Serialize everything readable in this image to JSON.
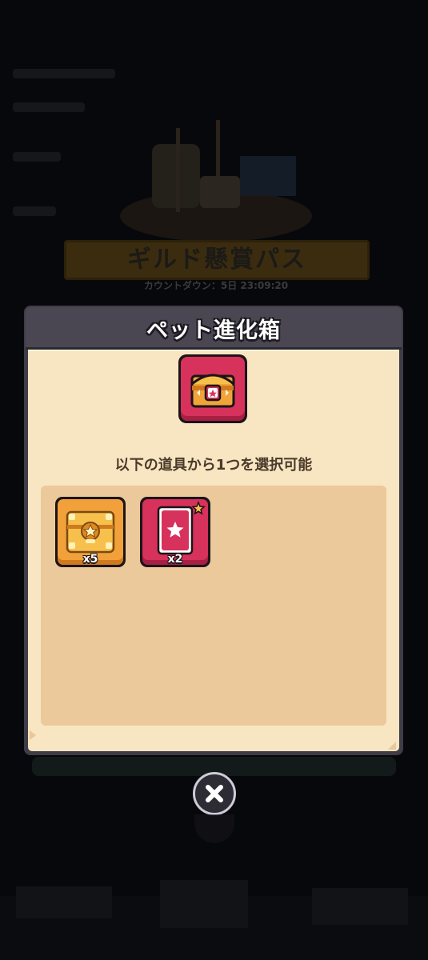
{
  "background": {
    "banner_title": "ギルド懸賞パス",
    "countdown_label": "カウントダウン：5日 23:09:20"
  },
  "dialog": {
    "title": "ペット進化箱",
    "description": "以下の道具から1つを選択可能",
    "chest_icon": "pet-evolution-chest-icon",
    "items": [
      {
        "icon": "golden-chest-icon",
        "quantity": "x5"
      },
      {
        "icon": "star-card-icon",
        "quantity": "x2"
      }
    ]
  },
  "close_button": {
    "icon": "close-icon"
  },
  "colors": {
    "dialog_frame": "#3f3c47",
    "dialog_body": "#f8e5c1",
    "reward_panel": "#ecc99a",
    "accent_red": "#d6325b",
    "accent_orange": "#f2a13a"
  }
}
